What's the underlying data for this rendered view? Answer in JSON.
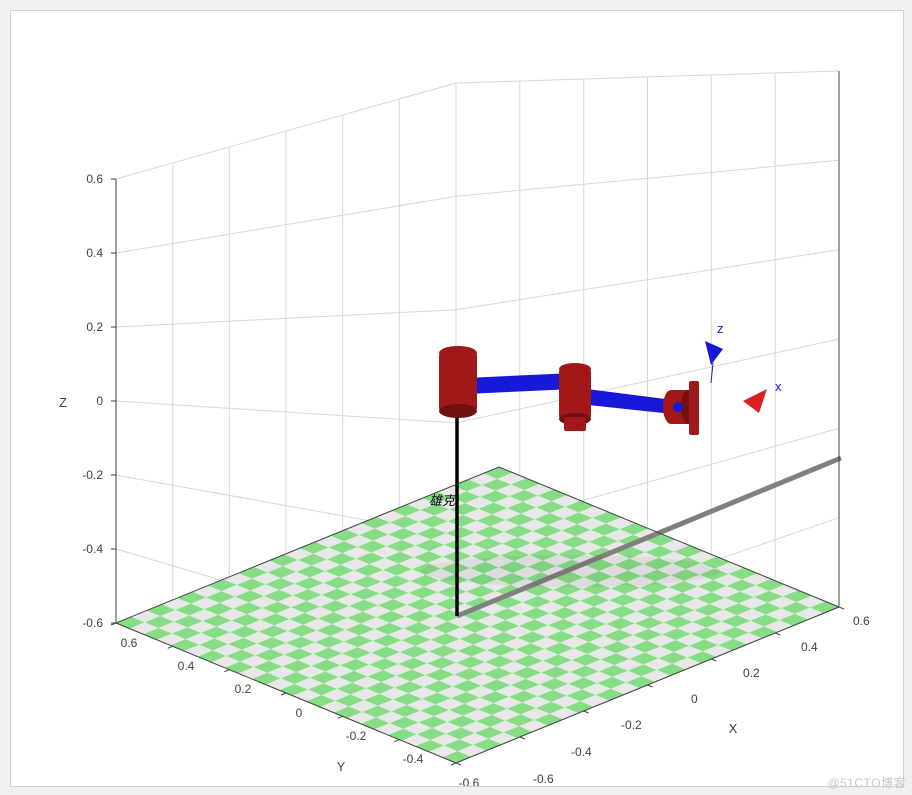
{
  "chart_data": {
    "type": "3d-scene",
    "title": "",
    "axes": {
      "x": {
        "label": "X",
        "min": -0.6,
        "max": 0.6,
        "ticks": [
          -0.6,
          -0.4,
          -0.2,
          0,
          0.2,
          0.4,
          0.6
        ]
      },
      "y": {
        "label": "Y",
        "min": -0.6,
        "max": 0.6,
        "ticks": [
          -0.6,
          -0.4,
          -0.2,
          0,
          0.2,
          0.4,
          0.6
        ]
      },
      "z": {
        "label": "Z",
        "min": -0.6,
        "max": 0.6,
        "ticks": [
          -0.6,
          -0.4,
          -0.2,
          0,
          0.2,
          0.4,
          0.6
        ]
      }
    },
    "floor": {
      "z": -0.64,
      "checker": 25,
      "extent": [
        -0.65,
        0.65
      ]
    },
    "robot": {
      "name": "雄克",
      "base": {
        "pos": [
          0,
          0,
          -0.64
        ],
        "pose_line_to": [
          0,
          0,
          0.05
        ]
      },
      "joints": [
        {
          "type": "revolute",
          "center": [
            0.0,
            0.0,
            0.04
          ],
          "axis": "z"
        },
        {
          "type": "revolute",
          "center": [
            0.23,
            0.0,
            0.0
          ],
          "axis": "z"
        },
        {
          "type": "revolute",
          "center": [
            0.43,
            0.0,
            0.0
          ],
          "axis": "x"
        }
      ],
      "links": [
        {
          "from": [
            0.0,
            0,
            0.03
          ],
          "to": [
            0.23,
            0,
            0.03
          ]
        },
        {
          "from": [
            0.23,
            0,
            0.0
          ],
          "to": [
            0.43,
            0,
            0.0
          ]
        }
      ],
      "end_effector_frame": {
        "origin": [
          0.46,
          0,
          0
        ],
        "x_axis_label": "x",
        "z_axis_label": "z"
      }
    },
    "ground_marks": {
      "origin_line_x": {
        "from": [
          0,
          0,
          -0.64
        ],
        "to": [
          0.65,
          0,
          -0.64
        ]
      }
    }
  },
  "watermark": "@51CTO博客"
}
